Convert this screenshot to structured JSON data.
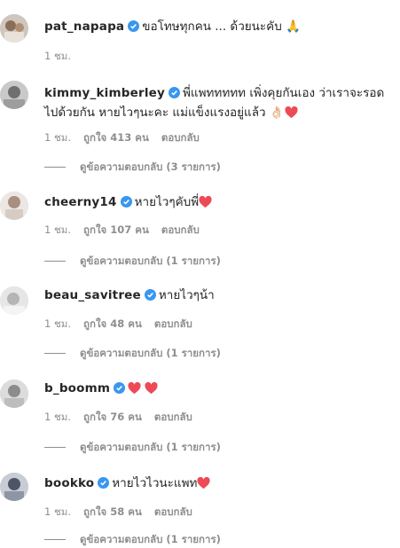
{
  "comments": [
    {
      "username": "pat_napapa",
      "text": "ขอโทษทุกคน ... ด้วยนะคับ 🙏",
      "time": "1 ชม.",
      "likes": "",
      "reply": "",
      "view_replies": "",
      "hearts": 0
    },
    {
      "username": "kimmy_kimberley",
      "text": "พี่แพททททท เพิ่งคุยกันเอง ว่าเราจะรอดไปด้วยกัน หายไวๆนะคะ แม่แข็งแรงอยู่แล้ว 👌🏻",
      "time": "1 ชม.",
      "likes": "ถูกใจ 413 คน",
      "reply": "ตอบกลับ",
      "view_replies": "ดูข้อความตอบกลับ (3 รายการ)",
      "hearts": 1
    },
    {
      "username": "cheerny14",
      "text": "หายไวๆคับพี่",
      "time": "1 ชม.",
      "likes": "ถูกใจ 107 คน",
      "reply": "ตอบกลับ",
      "view_replies": "ดูข้อความตอบกลับ (1 รายการ)",
      "hearts": 1
    },
    {
      "username": "beau_savitree",
      "text": "หายไวๆน้า",
      "time": "1 ชม.",
      "likes": "ถูกใจ 48 คน",
      "reply": "ตอบกลับ",
      "view_replies": "ดูข้อความตอบกลับ (1 รายการ)",
      "hearts": 0
    },
    {
      "username": "b_boomm",
      "text": "",
      "time": "1 ชม.",
      "likes": "ถูกใจ 76 คน",
      "reply": "ตอบกลับ",
      "view_replies": "ดูข้อความตอบกลับ (1 รายการ)",
      "hearts": 2
    },
    {
      "username": "bookko",
      "text": "หายไวไวนะแพท",
      "time": "1 ชม.",
      "likes": "ถูกใจ 58 คน",
      "reply": "ตอบกลับ",
      "view_replies": "ดูข้อความตอบกลับ (1 รายการ)",
      "hearts": 1
    }
  ],
  "colors": {
    "verified": "#3897f0",
    "heart": "#ed4956",
    "meta": "#8e8e8e"
  }
}
